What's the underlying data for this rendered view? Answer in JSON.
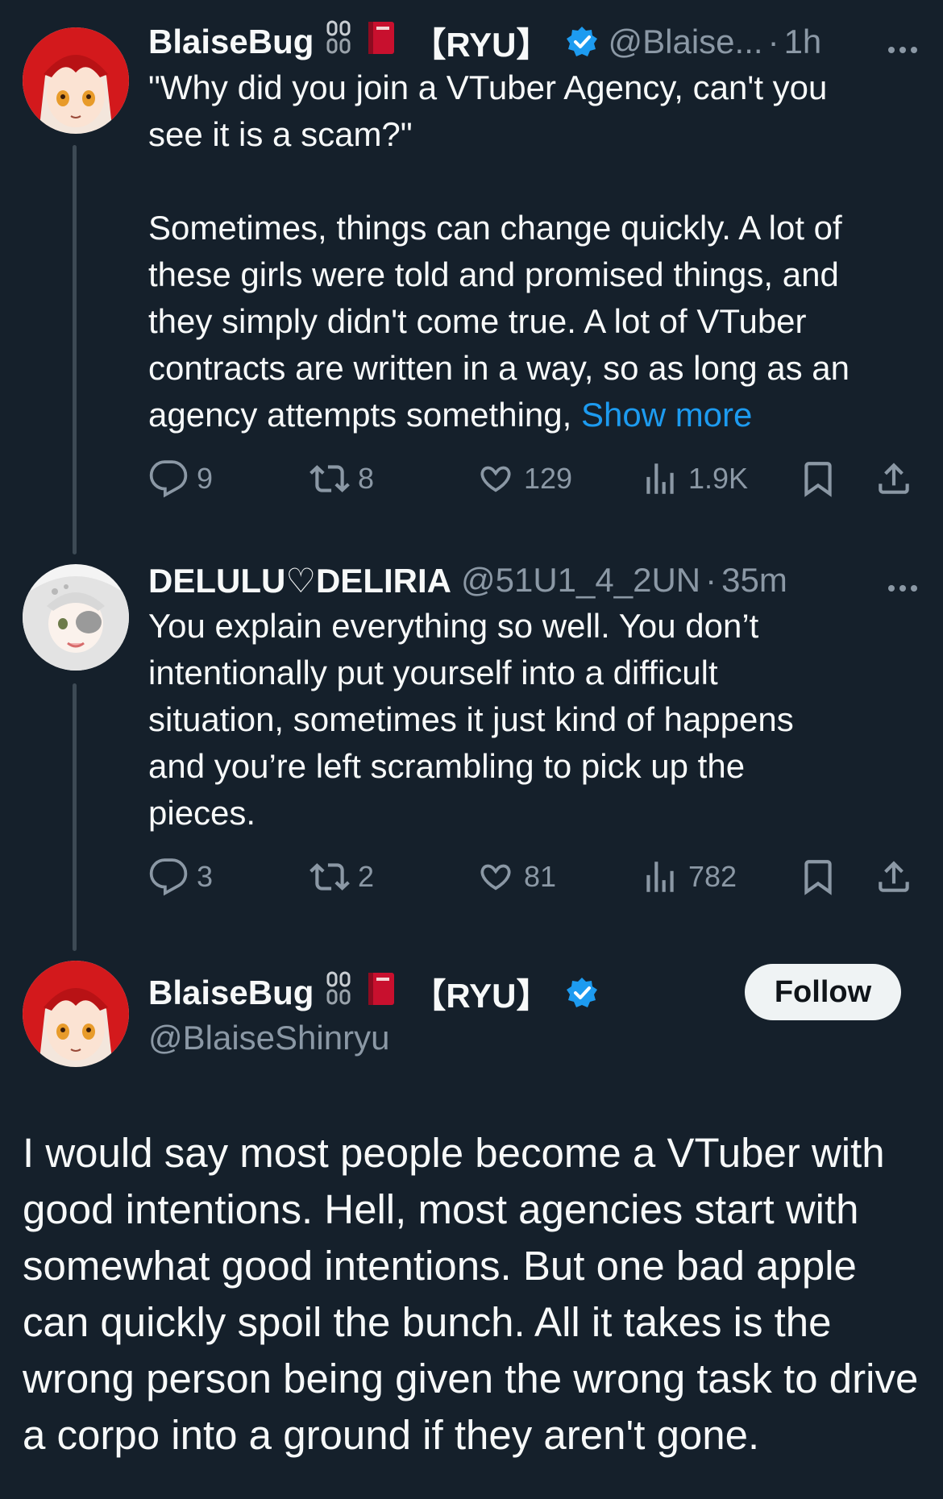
{
  "tweets": [
    {
      "display_name": "BlaiseBug",
      "emoji_1": "⛓",
      "emoji_2": "📕",
      "ryu_tag": "【RYU】",
      "handle": "@Blaise...",
      "separator": "·",
      "time": "1h",
      "text": "\"Why did you join a VTuber Agency, can't you\nsee it is a scam?\"\n\nSometimes, things can change quickly. A lot of\nthese girls were told and promised things, and\nthey simply didn't come true. A lot of VTuber\ncontracts are written in a way, so as long as an\nagency attempts something, ",
      "show_more": "Show more",
      "replies": "9",
      "reposts": "8",
      "likes": "129",
      "views": "1.9K"
    },
    {
      "display_name": "DELULU♡DELIRIA",
      "handle": "@51U1_4_2UN",
      "separator": "·",
      "time": "35m",
      "text": "You explain everything so well. You don’t\nintentionally put yourself into a difficult\nsituation, sometimes it just kind of happens\nand you’re left scrambling to pick up the\npieces.",
      "replies": "3",
      "reposts": "2",
      "likes": "81",
      "views": "782"
    }
  ],
  "main_tweet": {
    "display_name": "BlaiseBug",
    "emoji_1": "⛓",
    "emoji_2": "📕",
    "ryu_tag": "【RYU】",
    "handle": "@BlaiseShinryu",
    "follow_label": "Follow",
    "text": "I would say most people become a VTuber with good intentions. Hell, most agencies start with somewhat good intentions. But one bad apple can quickly spoil the bunch. All it takes is the wrong person being given the wrong task to drive a corpo into a ground if they aren't gone."
  },
  "colors": {
    "background": "#15202b",
    "text": "#f7f9f9",
    "secondary": "#8b98a5",
    "accent": "#1d9bf0",
    "thread_line": "#3d4a55"
  }
}
